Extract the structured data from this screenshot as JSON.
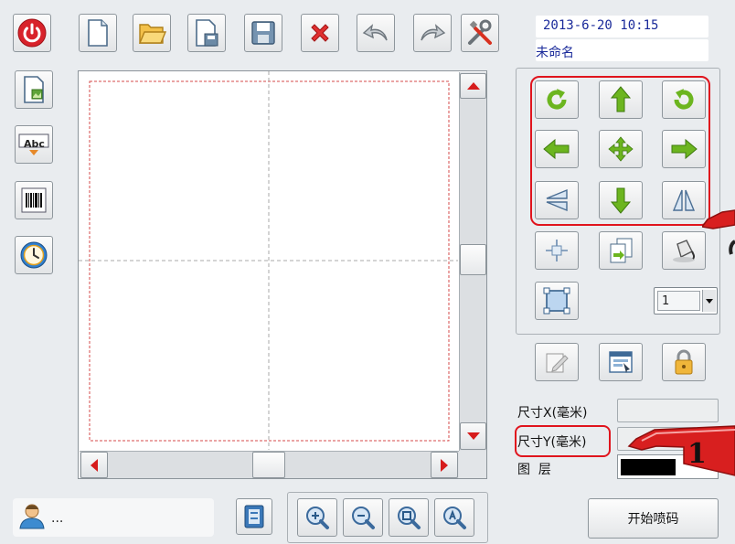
{
  "header": {
    "datetime": "2013-6-20 10:15",
    "doc_name": "未命名"
  },
  "toolbar": {
    "buttons": [
      "power-icon",
      "new-file-icon",
      "open-folder-icon",
      "save-as-icon",
      "save-icon",
      "delete-icon",
      "undo-icon",
      "redo-icon",
      "tools-icon"
    ]
  },
  "left_tools": {
    "abc_label": "Abc"
  },
  "layer_select": {
    "value": "1"
  },
  "props": {
    "size_x_label": "尺寸X(毫米)",
    "size_y_label": "尺寸Y(毫米)",
    "layer_label": "图  层"
  },
  "annotation": {
    "marker_number": "1"
  },
  "status": {
    "user_text": "..."
  },
  "actions": {
    "start_label": "开始喷码"
  },
  "colors": {
    "accent_green": "#7cc527",
    "callout_red": "#e0141d",
    "text_blue": "#1a2a9a"
  }
}
